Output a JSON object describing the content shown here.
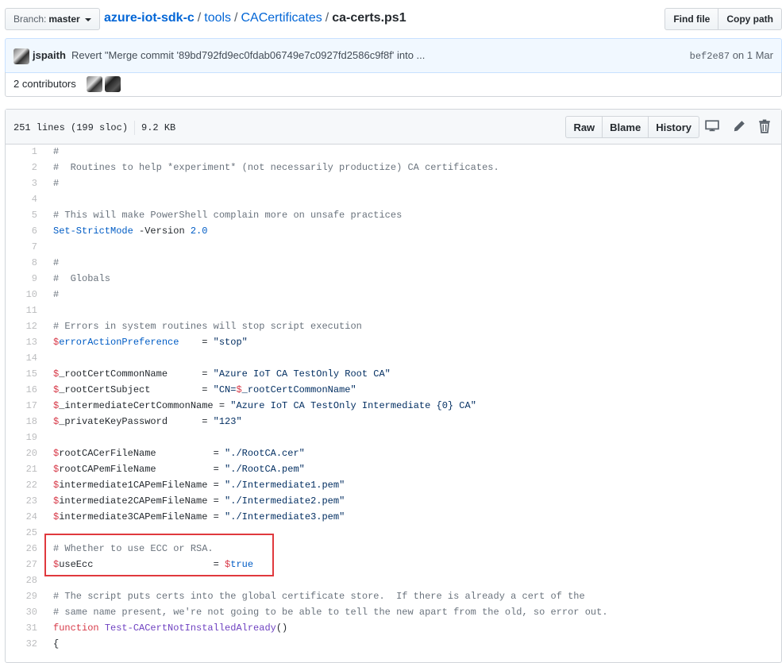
{
  "branch": {
    "label": "Branch:",
    "value": "master"
  },
  "breadcrumb": {
    "repo": "azure-iot-sdk-c",
    "sep": "/",
    "dir1": "tools",
    "dir2": "CACertificates",
    "file": "ca-certs.ps1"
  },
  "header_buttons": {
    "find_file": "Find file",
    "copy_path": "Copy path"
  },
  "commit": {
    "author": "jspaith",
    "message": "Revert \"Merge commit '89bd792fd9ec0fdab06749e7c0927fd2586c9f8f' into ...",
    "sha": "bef2e87",
    "date": "on 1 Mar"
  },
  "contributors": {
    "label": "2 contributors"
  },
  "file": {
    "lines_info": "251 lines (199 sloc)",
    "size": "9.2 KB",
    "raw": "Raw",
    "blame": "Blame",
    "history": "History"
  },
  "icons": [
    "desktop-icon",
    "pencil-icon",
    "trash-icon",
    "caret-down-icon"
  ],
  "colors": {
    "link": "#0366d6",
    "comment": "#6a737d",
    "variable": "#d73a49",
    "string": "#032f62",
    "highlight": "#e0393e"
  },
  "code_lines": [
    {
      "n": "1",
      "parts": [
        [
          "c-comment",
          "#"
        ]
      ]
    },
    {
      "n": "2",
      "parts": [
        [
          "c-comment",
          "#  Routines to help *experiment* (not necessarily productize) CA certificates."
        ]
      ]
    },
    {
      "n": "3",
      "parts": [
        [
          "c-comment",
          "#"
        ]
      ]
    },
    {
      "n": "4",
      "parts": []
    },
    {
      "n": "5",
      "parts": [
        [
          "c-comment",
          "# This will make PowerShell complain more on unsafe practices"
        ]
      ]
    },
    {
      "n": "6",
      "parts": [
        [
          "c-cmd",
          "Set-StrictMode"
        ],
        [
          "",
          " -Version "
        ],
        [
          "c-num",
          "2.0"
        ]
      ]
    },
    {
      "n": "7",
      "parts": []
    },
    {
      "n": "8",
      "parts": [
        [
          "c-comment",
          "#"
        ]
      ]
    },
    {
      "n": "9",
      "parts": [
        [
          "c-comment",
          "#  Globals"
        ]
      ]
    },
    {
      "n": "10",
      "parts": [
        [
          "c-comment",
          "#"
        ]
      ]
    },
    {
      "n": "11",
      "parts": []
    },
    {
      "n": "12",
      "parts": [
        [
          "c-comment",
          "# Errors in system routines will stop script execution"
        ]
      ]
    },
    {
      "n": "13",
      "parts": [
        [
          "c-var",
          "$"
        ],
        [
          "c-cmd",
          "errorActionPreference"
        ],
        [
          "",
          "    = "
        ],
        [
          "c-str",
          "\"stop\""
        ]
      ]
    },
    {
      "n": "14",
      "parts": []
    },
    {
      "n": "15",
      "parts": [
        [
          "c-var",
          "$"
        ],
        [
          "",
          "_rootCertCommonName      = "
        ],
        [
          "c-str",
          "\"Azure IoT CA TestOnly Root CA\""
        ]
      ]
    },
    {
      "n": "16",
      "parts": [
        [
          "c-var",
          "$"
        ],
        [
          "",
          "_rootCertSubject         = "
        ],
        [
          "c-str",
          "\"CN="
        ],
        [
          "c-var",
          "$"
        ],
        [
          "c-str",
          "_rootCertCommonName\""
        ]
      ]
    },
    {
      "n": "17",
      "parts": [
        [
          "c-var",
          "$"
        ],
        [
          "",
          "_intermediateCertCommonName = "
        ],
        [
          "c-str",
          "\"Azure IoT CA TestOnly Intermediate {0} CA\""
        ]
      ]
    },
    {
      "n": "18",
      "parts": [
        [
          "c-var",
          "$"
        ],
        [
          "",
          "_privateKeyPassword      = "
        ],
        [
          "c-str",
          "\"123\""
        ]
      ]
    },
    {
      "n": "19",
      "parts": []
    },
    {
      "n": "20",
      "parts": [
        [
          "c-var",
          "$"
        ],
        [
          "",
          "rootCACerFileName          = "
        ],
        [
          "c-str",
          "\"./RootCA.cer\""
        ]
      ]
    },
    {
      "n": "21",
      "parts": [
        [
          "c-var",
          "$"
        ],
        [
          "",
          "rootCAPemFileName          = "
        ],
        [
          "c-str",
          "\"./RootCA.pem\""
        ]
      ]
    },
    {
      "n": "22",
      "parts": [
        [
          "c-var",
          "$"
        ],
        [
          "",
          "intermediate1CAPemFileName = "
        ],
        [
          "c-str",
          "\"./Intermediate1.pem\""
        ]
      ]
    },
    {
      "n": "23",
      "parts": [
        [
          "c-var",
          "$"
        ],
        [
          "",
          "intermediate2CAPemFileName = "
        ],
        [
          "c-str",
          "\"./Intermediate2.pem\""
        ]
      ]
    },
    {
      "n": "24",
      "parts": [
        [
          "c-var",
          "$"
        ],
        [
          "",
          "intermediate3CAPemFileName = "
        ],
        [
          "c-str",
          "\"./Intermediate3.pem\""
        ]
      ]
    },
    {
      "n": "25",
      "parts": []
    },
    {
      "n": "26",
      "parts": [
        [
          "c-comment",
          "# Whether to use ECC or RSA."
        ]
      ]
    },
    {
      "n": "27",
      "parts": [
        [
          "c-var",
          "$"
        ],
        [
          "",
          "useEcc                     = "
        ],
        [
          "c-var",
          "$"
        ],
        [
          "c-cmd",
          "true"
        ]
      ]
    },
    {
      "n": "28",
      "parts": []
    },
    {
      "n": "29",
      "parts": [
        [
          "c-comment",
          "# The script puts certs into the global certificate store.  If there is already a cert of the"
        ]
      ]
    },
    {
      "n": "30",
      "parts": [
        [
          "c-comment",
          "# same name present, we're not going to be able to tell the new apart from the old, so error out."
        ]
      ]
    },
    {
      "n": "31",
      "parts": [
        [
          "c-kw",
          "function"
        ],
        [
          "",
          " "
        ],
        [
          "c-fn",
          "Test-CACertNotInstalledAlready"
        ],
        [
          "",
          "()"
        ]
      ]
    },
    {
      "n": "32",
      "parts": [
        [
          "",
          "{"
        ]
      ]
    }
  ]
}
